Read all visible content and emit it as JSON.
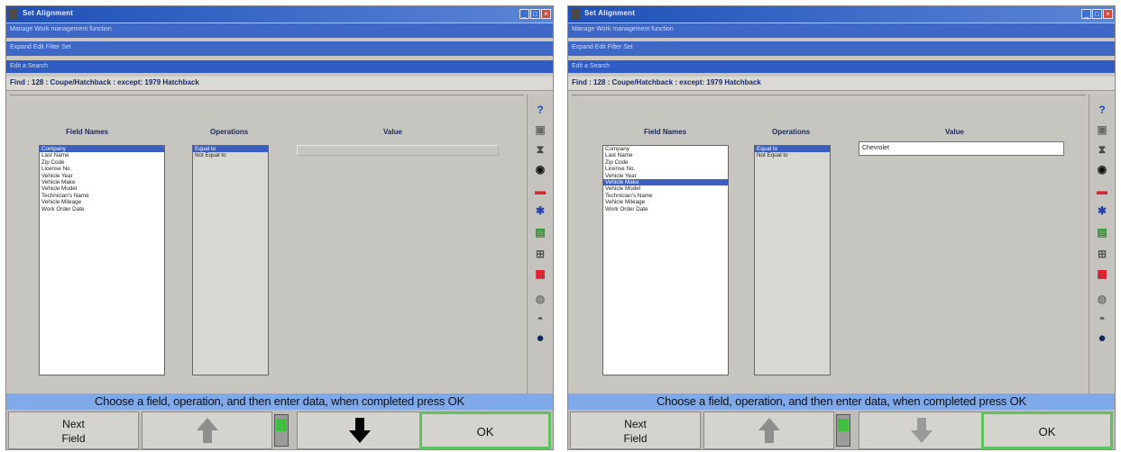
{
  "panels": [
    {
      "window_title": "Set Alignment",
      "subtitle_1": "Manage Work management function",
      "subtitle_2": "Expand Edit Filter Set",
      "subtitle_3": "Edit a Search",
      "heading": "Find : 128 : Coupe/Hatchback : except: 1979 Hatchback",
      "field_names_label": "Field Names",
      "operations_label": "Operations",
      "value_label": "Value",
      "value": "",
      "field_names": [
        "Company",
        "Last Name",
        "Zip Code",
        "License No.",
        "Vehicle Year",
        "Vehicle Make",
        "Vehicle Model",
        "Technician's Name",
        "Vehicle Mileage",
        "Work Order Date"
      ],
      "selected_field": 0,
      "operations": [
        "Equal to",
        "Not Equal to"
      ],
      "selected_operation": 0,
      "status": "Choose a field, operation, and then enter data, when completed press OK",
      "next_field_label": "Next Field",
      "ok_label": "OK",
      "down_arrow_color": "#000000"
    },
    {
      "window_title": "Set Alignment",
      "subtitle_1": "Manage Work management function",
      "subtitle_2": "Expand Edit Filter Set",
      "subtitle_3": "Edit a Search",
      "heading": "Find : 128 : Coupe/Hatchback : except: 1979 Hatchback",
      "field_names_label": "Field Names",
      "operations_label": "Operations",
      "value_label": "Value",
      "value": "Chevrolet",
      "field_names": [
        "Company",
        "Last Name",
        "Zip Code",
        "License No.",
        "Vehicle Year",
        "Vehicle Make",
        "Vehicle Model",
        "Technician's Name",
        "Vehicle Mileage",
        "Work Order Date"
      ],
      "selected_field": 5,
      "operations": [
        "Equal to",
        "Not Equal to"
      ],
      "selected_operation": 0,
      "status": "Choose a field, operation, and then enter data, when completed press OK",
      "next_field_label": "Next Field",
      "ok_label": "OK",
      "down_arrow_color": "#9a9a9a"
    }
  ],
  "colors": {
    "accent": "#3a5fbf",
    "status_bar": "#7fa9e8",
    "ok_border": "#5fc15f"
  },
  "toolbar_icons": [
    "help-icon",
    "camera-icon",
    "vehicle-icon",
    "tire-icon",
    "graph-icon",
    "spring-icon",
    "meter-icon",
    "lift-icon",
    "tools-icon",
    "disc-icon",
    "cd-icon",
    "globe-icon"
  ]
}
